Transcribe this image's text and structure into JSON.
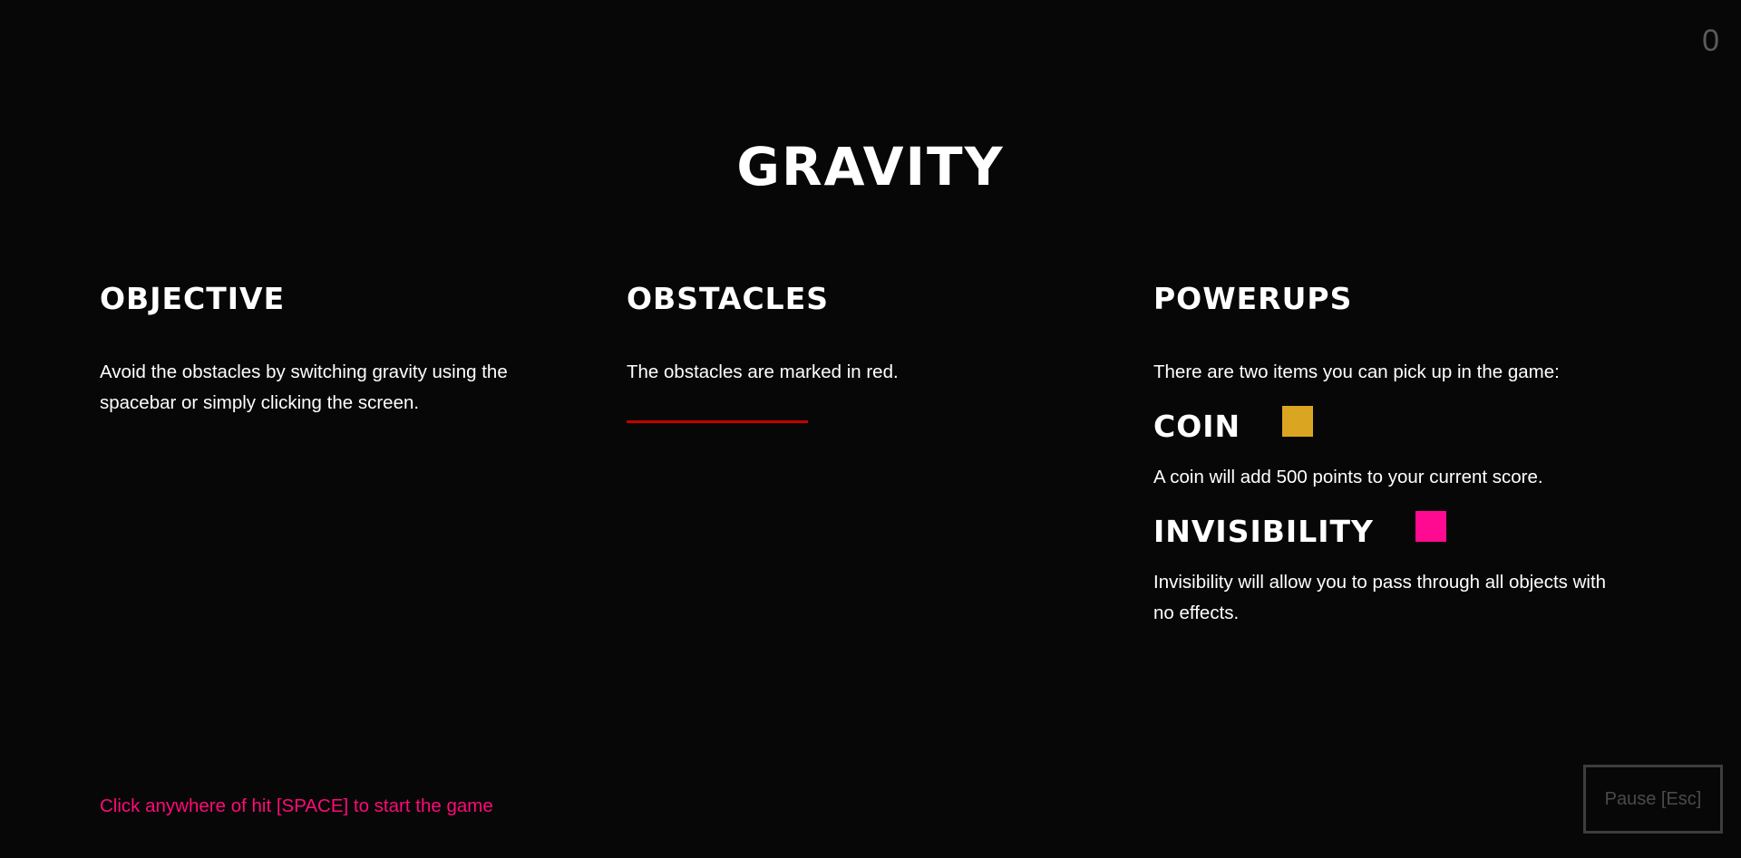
{
  "score": "0",
  "title": "GRAVITY",
  "objective": {
    "heading": "OBJECTIVE",
    "text": "Avoid the obstacles by switching gravity using the spacebar or simply clicking the screen."
  },
  "obstacles": {
    "heading": "OBSTACLES",
    "text": "The obstacles are marked in red.",
    "color": "#c40000"
  },
  "powerups": {
    "heading": "POWERUPS",
    "intro": "There are two items you can pick up in the game:",
    "items": [
      {
        "name": "COIN",
        "color": "#daa520",
        "description": "A coin will add 500 points to your current score."
      },
      {
        "name": "INVISIBILITY",
        "color": "#ff0a90",
        "description": "Invisibility will allow you to pass through all objects with no effects."
      }
    ]
  },
  "start_hint": "Click anywhere of hit [SPACE] to start the game",
  "pause_label": "Pause [Esc]",
  "colors": {
    "background": "#070707",
    "hint": "#ff0a78"
  }
}
